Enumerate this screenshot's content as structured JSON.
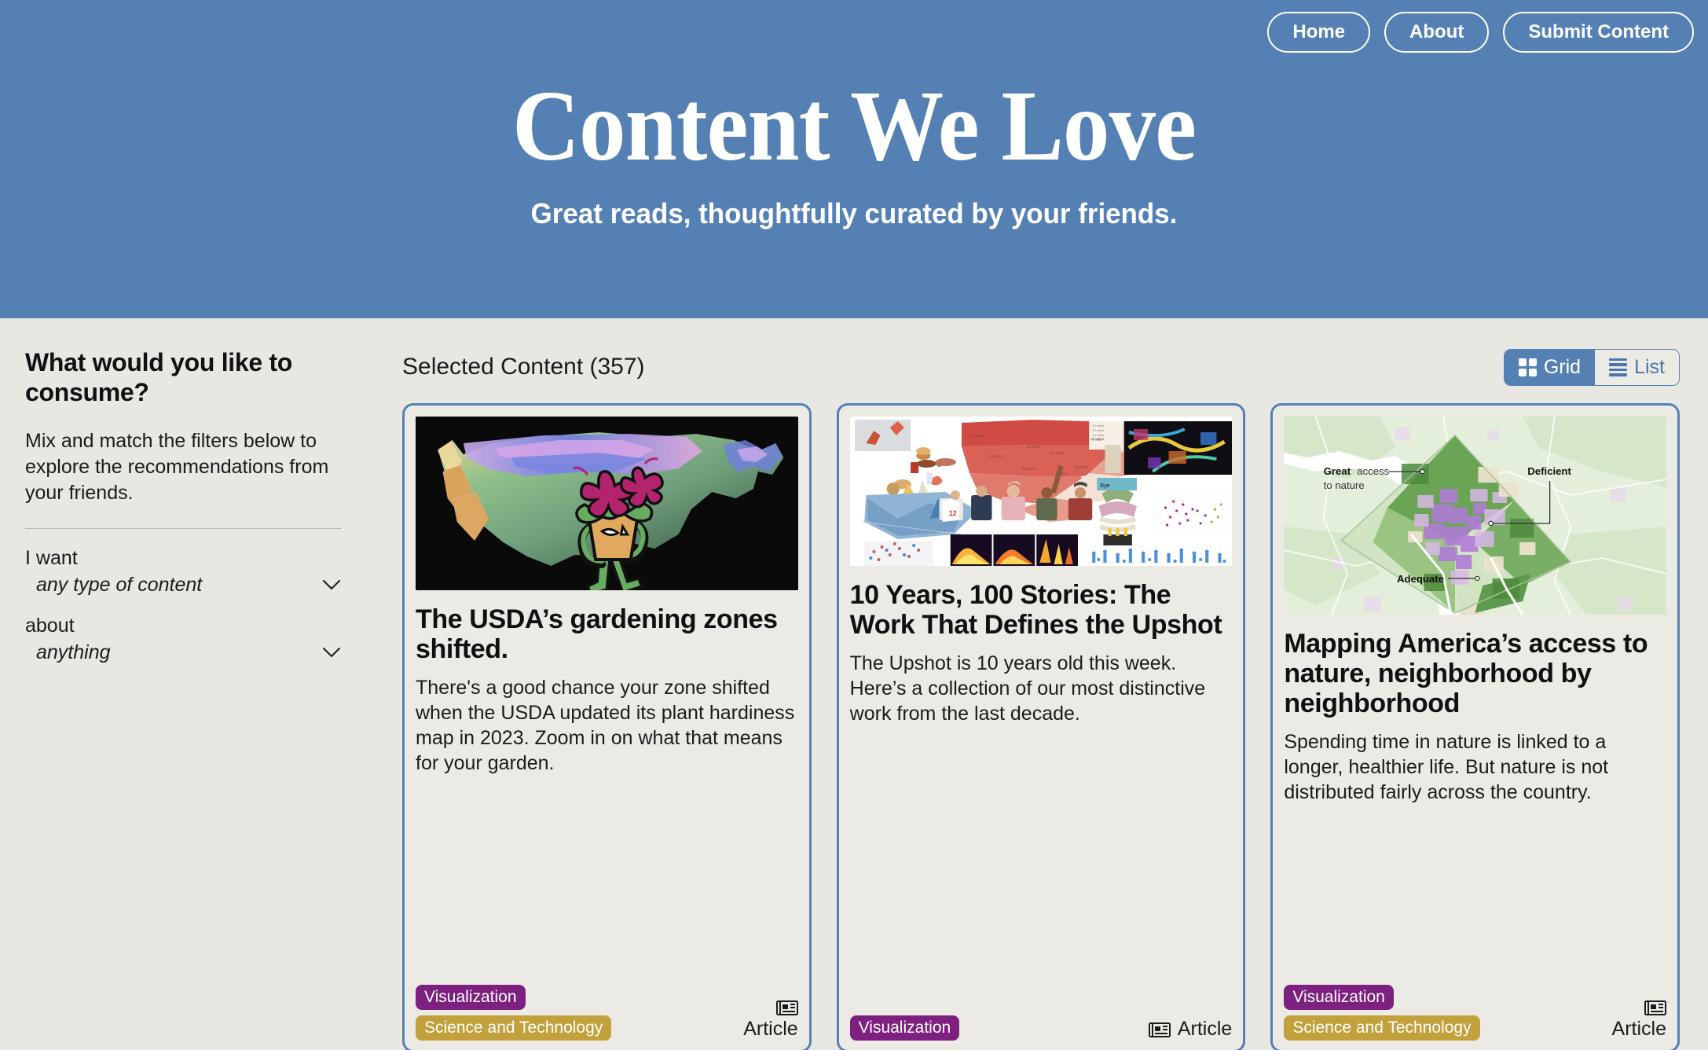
{
  "header": {
    "title": "Content We Love",
    "tagline": "Great reads, thoughtfully curated by your friends.",
    "brand_color": "#5580b4",
    "nav": [
      {
        "label": "Home"
      },
      {
        "label": "About"
      },
      {
        "label": "Submit Content"
      }
    ]
  },
  "sidebar": {
    "heading": "What would you like to consume?",
    "description": "Mix and match the filters below to explore the recommendations from your friends.",
    "filters": [
      {
        "label": "I want",
        "value": "any type of content",
        "icon": "chevron-down-icon"
      },
      {
        "label": "about",
        "value": "anything",
        "icon": "chevron-down-icon"
      }
    ]
  },
  "main": {
    "results_label": "Selected Content (357)",
    "results_count": 357,
    "view_toggle": {
      "grid_label": "Grid",
      "list_label": "List",
      "active": "Grid"
    },
    "cards": [
      {
        "title": "The USDA’s gardening zones shifted.",
        "description": "There's a good chance your zone shifted when the USDA updated its plant hardiness map in 2023. Zoom in on what that means for your garden.",
        "tags": [
          {
            "label": "Visualization",
            "color": "#7d207f"
          },
          {
            "label": "Science and Technology",
            "color": "#c2a03c"
          }
        ],
        "content_type": "Article",
        "content_type_icon": "newspaper-icon",
        "thumbnail": "usda-hardiness-map-flowerpot-illustration",
        "footer_layout": "stacked"
      },
      {
        "title": "10 Years, 100 Stories: The Work That Defines the Upshot",
        "description": "The Upshot is 10 years old this week. Here’s a collection of our most distinctive work from the last decade.",
        "tags": [
          {
            "label": "Visualization",
            "color": "#7d207f"
          }
        ],
        "content_type": "Article",
        "content_type_icon": "newspaper-icon",
        "thumbnail": "upshot-collage-of-visualizations",
        "footer_layout": "inline"
      },
      {
        "title": "Mapping America’s access to nature, neighborhood by neighborhood",
        "description": "Spending time in nature is linked to a longer, healthier life. But nature is not distributed fairly across the country.",
        "tags": [
          {
            "label": "Visualization",
            "color": "#7d207f"
          },
          {
            "label": "Science and Technology",
            "color": "#c2a03c"
          }
        ],
        "content_type": "Article",
        "content_type_icon": "newspaper-icon",
        "thumbnail": "dc-nature-access-map",
        "thumbnail_annotations": [
          "Great access",
          "to nature",
          "Deficient",
          "Adequate"
        ],
        "footer_layout": "stacked"
      }
    ]
  }
}
